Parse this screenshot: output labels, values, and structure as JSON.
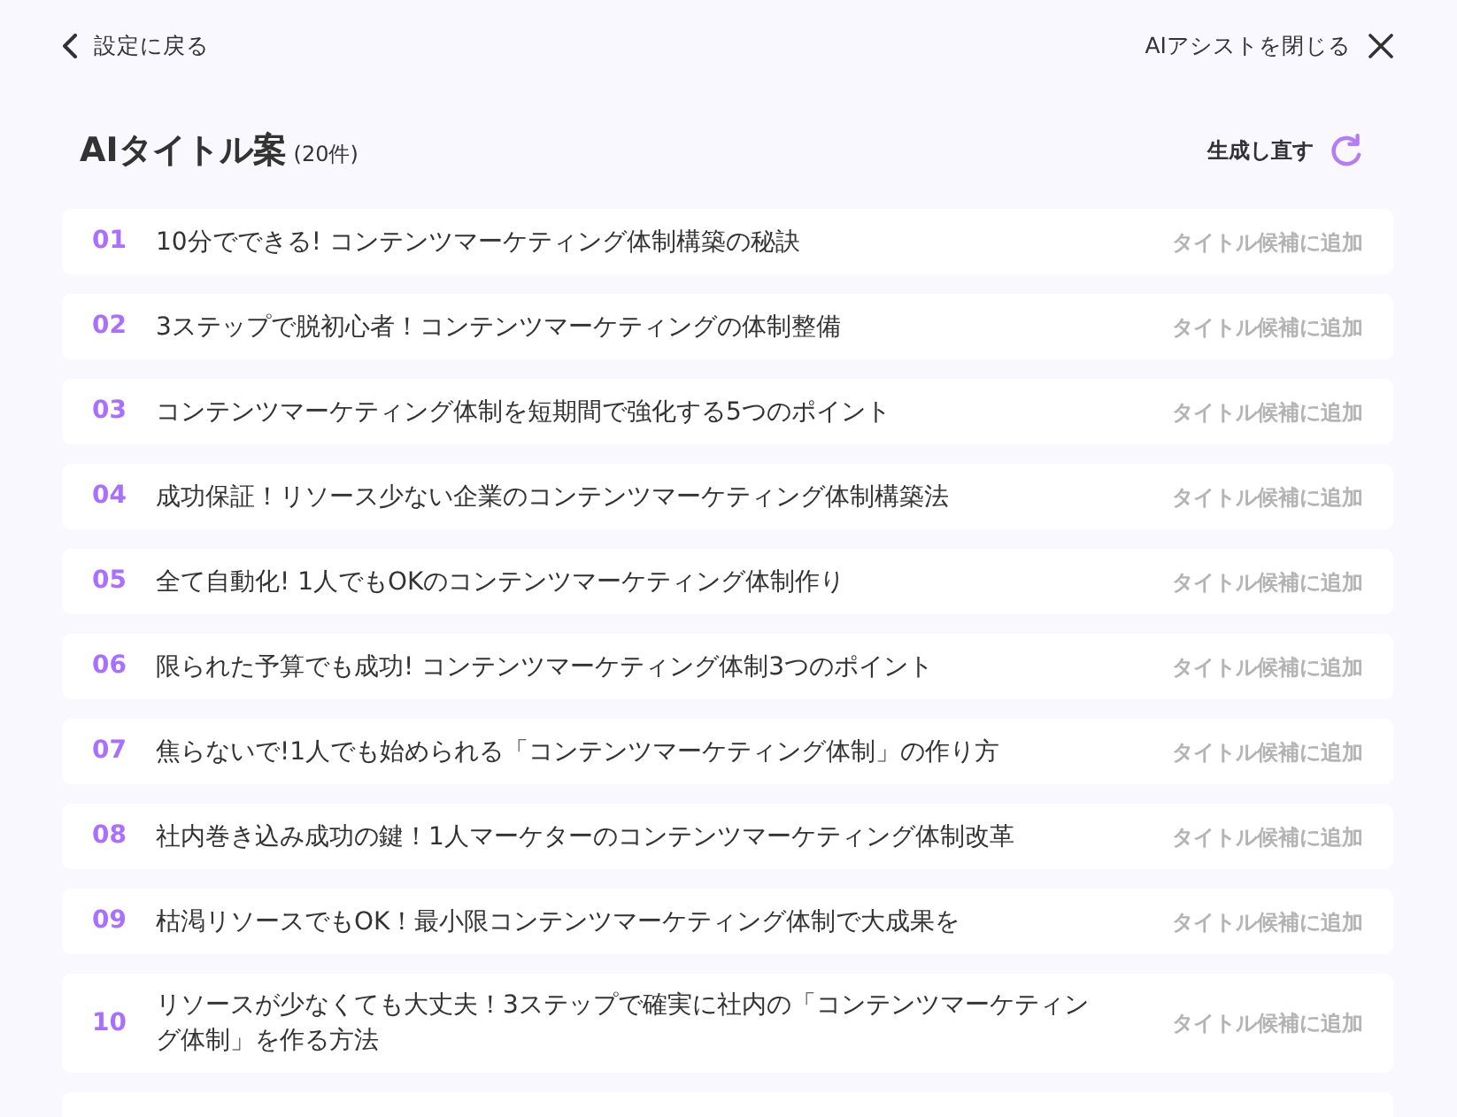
{
  "header": {
    "back_label": "設定に戻る",
    "close_label": "AIアシストを閉じる"
  },
  "heading": {
    "title": "AIタイトル案",
    "count": "(20件)",
    "regenerate_label": "生成し直す"
  },
  "titles": [
    {
      "number": "01",
      "text": "10分でできる! コンテンツマーケティング体制構築の秘訣",
      "action": "タイトル候補に追加",
      "disabled": true
    },
    {
      "number": "02",
      "text": "3ステップで脱初心者！コンテンツマーケティングの体制整備",
      "action": "タイトル候補に追加",
      "disabled": true
    },
    {
      "number": "03",
      "text": "コンテンツマーケティング体制を短期間で強化する5つのポイント",
      "action": "タイトル候補に追加",
      "disabled": true
    },
    {
      "number": "04",
      "text": "成功保証！リソース少ない企業のコンテンツマーケティング体制構築法",
      "action": "タイトル候補に追加",
      "disabled": true
    },
    {
      "number": "05",
      "text": "全て自動化! 1人でもOKのコンテンツマーケティング体制作り",
      "action": "タイトル候補に追加",
      "disabled": true
    },
    {
      "number": "06",
      "text": "限られた予算でも成功! コンテンツマーケティング体制3つのポイント",
      "action": "タイトル候補に追加",
      "disabled": true
    },
    {
      "number": "07",
      "text": "焦らないで!1人でも始められる「コンテンツマーケティング体制」の作り方",
      "action": "タイトル候補に追加",
      "disabled": true
    },
    {
      "number": "08",
      "text": "社内巻き込み成功の鍵！1人マーケターのコンテンツマーケティング体制改革",
      "action": "タイトル候補に追加",
      "disabled": true
    },
    {
      "number": "09",
      "text": "枯渇リソースでもOK！最小限コンテンツマーケティング体制で大成果を",
      "action": "タイトル候補に追加",
      "disabled": true
    },
    {
      "number": "10",
      "text": "リソースが少なくても大丈夫！3ステップで確実に社内の「コンテンツマーケティング体制」を作る方法",
      "action": "タイトル候補に追加",
      "disabled": true
    }
  ]
}
